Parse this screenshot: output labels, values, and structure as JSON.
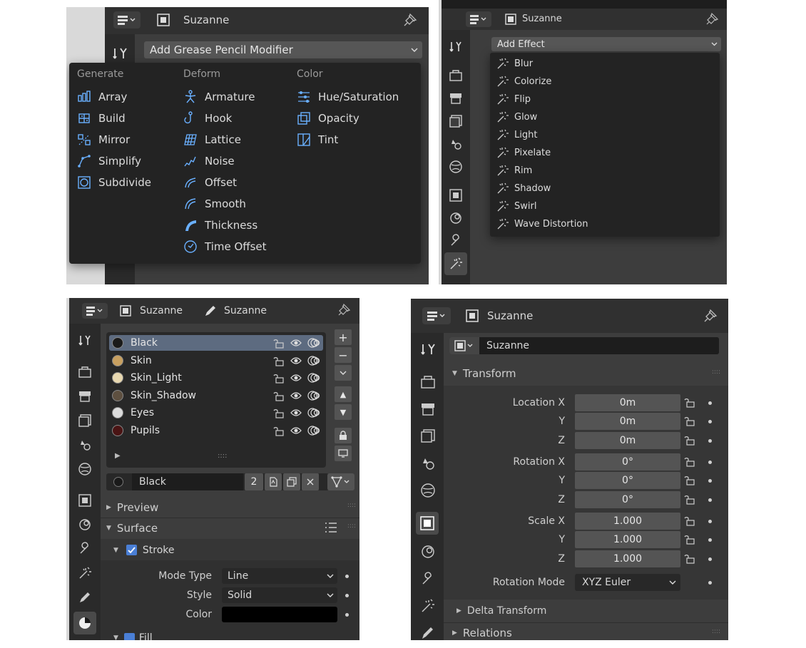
{
  "object_name": "Suzanne",
  "panel_modifiers": {
    "dropdown_label": "Add Grease Pencil Modifier",
    "columns": [
      {
        "heading": "Generate",
        "items": [
          {
            "label": "Array",
            "icon": "array-icon"
          },
          {
            "label": "Build",
            "icon": "build-icon"
          },
          {
            "label": "Mirror",
            "icon": "mirror-icon"
          },
          {
            "label": "Simplify",
            "icon": "simplify-icon"
          },
          {
            "label": "Subdivide",
            "icon": "subdivide-icon"
          }
        ]
      },
      {
        "heading": "Deform",
        "items": [
          {
            "label": "Armature",
            "icon": "armature-icon"
          },
          {
            "label": "Hook",
            "icon": "hook-icon"
          },
          {
            "label": "Lattice",
            "icon": "lattice-icon"
          },
          {
            "label": "Noise",
            "icon": "noise-icon"
          },
          {
            "label": "Offset",
            "icon": "offset-icon"
          },
          {
            "label": "Smooth",
            "icon": "smooth-icon"
          },
          {
            "label": "Thickness",
            "icon": "thickness-icon"
          },
          {
            "label": "Time Offset",
            "icon": "time-offset-icon"
          }
        ]
      },
      {
        "heading": "Color",
        "items": [
          {
            "label": "Hue/Saturation",
            "icon": "hue-saturation-icon"
          },
          {
            "label": "Opacity",
            "icon": "opacity-icon"
          },
          {
            "label": "Tint",
            "icon": "tint-icon"
          }
        ]
      }
    ]
  },
  "panel_effects": {
    "dropdown_label": "Add Effect",
    "items": [
      "Blur",
      "Colorize",
      "Flip",
      "Glow",
      "Light",
      "Pixelate",
      "Rim",
      "Shadow",
      "Swirl",
      "Wave Distortion"
    ]
  },
  "panel_materials": {
    "data_name": "Suzanne",
    "slots": [
      {
        "name": "Black",
        "color": "#1a1a1a",
        "selected": true
      },
      {
        "name": "Skin",
        "color": "#c8a060"
      },
      {
        "name": "Skin_Light",
        "color": "#e8d8b0"
      },
      {
        "name": "Skin_Shadow",
        "color": "#5e5040"
      },
      {
        "name": "Eyes",
        "color": "#dcdcdc"
      },
      {
        "name": "Pupils",
        "color": "#4a1414"
      }
    ],
    "active_material": "Black",
    "users_count": "2",
    "sections": {
      "preview": "Preview",
      "surface": "Surface",
      "stroke": "Stroke",
      "fill": "Fill"
    },
    "stroke": {
      "mode_type_label": "Mode Type",
      "mode_type_value": "Line",
      "style_label": "Style",
      "style_value": "Solid",
      "color_label": "Color",
      "color_value": "#000000"
    }
  },
  "panel_object": {
    "object_field": "Suzanne",
    "transform_title": "Transform",
    "rows": [
      {
        "label": "Location X",
        "value": "0m"
      },
      {
        "label": "Y",
        "value": "0m"
      },
      {
        "label": "Z",
        "value": "0m"
      },
      {
        "label": "Rotation X",
        "value": "0°"
      },
      {
        "label": "Y",
        "value": "0°"
      },
      {
        "label": "Z",
        "value": "0°"
      },
      {
        "label": "Scale X",
        "value": "1.000"
      },
      {
        "label": "Y",
        "value": "1.000"
      },
      {
        "label": "Z",
        "value": "1.000"
      }
    ],
    "rotation_mode_label": "Rotation Mode",
    "rotation_mode_value": "XYZ Euler",
    "delta_transform": "Delta Transform",
    "relations": "Relations"
  }
}
